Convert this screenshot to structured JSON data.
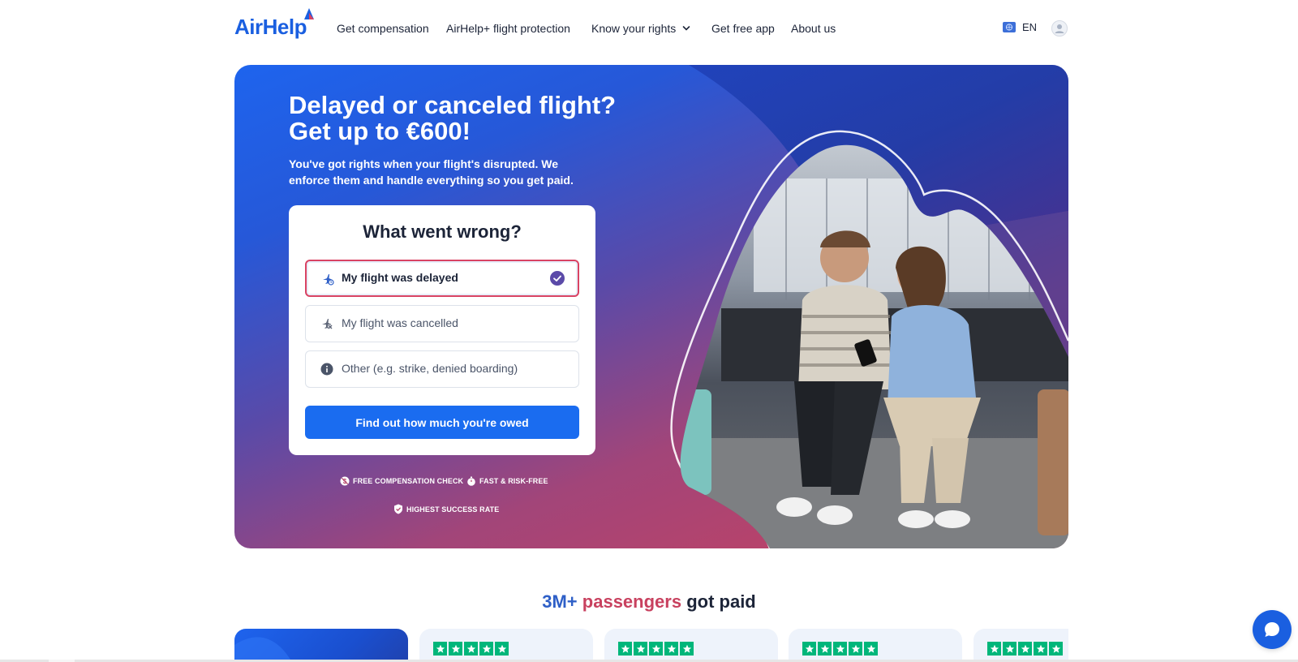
{
  "brand": {
    "name": "AirHelp"
  },
  "nav": {
    "items": [
      {
        "label": "Get compensation"
      },
      {
        "label": "AirHelp+ flight protection"
      },
      {
        "label": "Know your rights"
      },
      {
        "label": "Get free app"
      },
      {
        "label": "About us"
      }
    ],
    "language": "EN"
  },
  "hero": {
    "title_line1": "Delayed or canceled flight?",
    "title_line2": "Get up to €600!",
    "subtitle": "You've got rights when your flight's disrupted. We enforce them and handle everything so you get paid.",
    "card": {
      "title": "What went wrong?",
      "options": [
        {
          "label": "My flight was delayed",
          "icon": "plane-delay-icon",
          "selected": true
        },
        {
          "label": "My flight was cancelled",
          "icon": "plane-cancel-icon",
          "selected": false
        },
        {
          "label": "Other (e.g. strike, denied boarding)",
          "icon": "info-icon",
          "selected": false
        }
      ],
      "cta": "Find out how much you're owed"
    },
    "badges": [
      {
        "label": "FREE COMPENSATION CHECK",
        "icon": "no-fee-icon"
      },
      {
        "label": "FAST & RISK-FREE",
        "icon": "stopwatch-icon"
      },
      {
        "label": "HIGHEST SUCCESS RATE",
        "icon": "shield-check-icon"
      }
    ]
  },
  "section": {
    "title_part1": "3M+",
    "title_part2": "passengers",
    "title_part3": "got paid"
  },
  "colors": {
    "brand_blue": "#1a5fe0",
    "cta_blue": "#1a6cf0",
    "accent_pink": "#c8415f",
    "trustpilot_green": "#00b67a"
  }
}
